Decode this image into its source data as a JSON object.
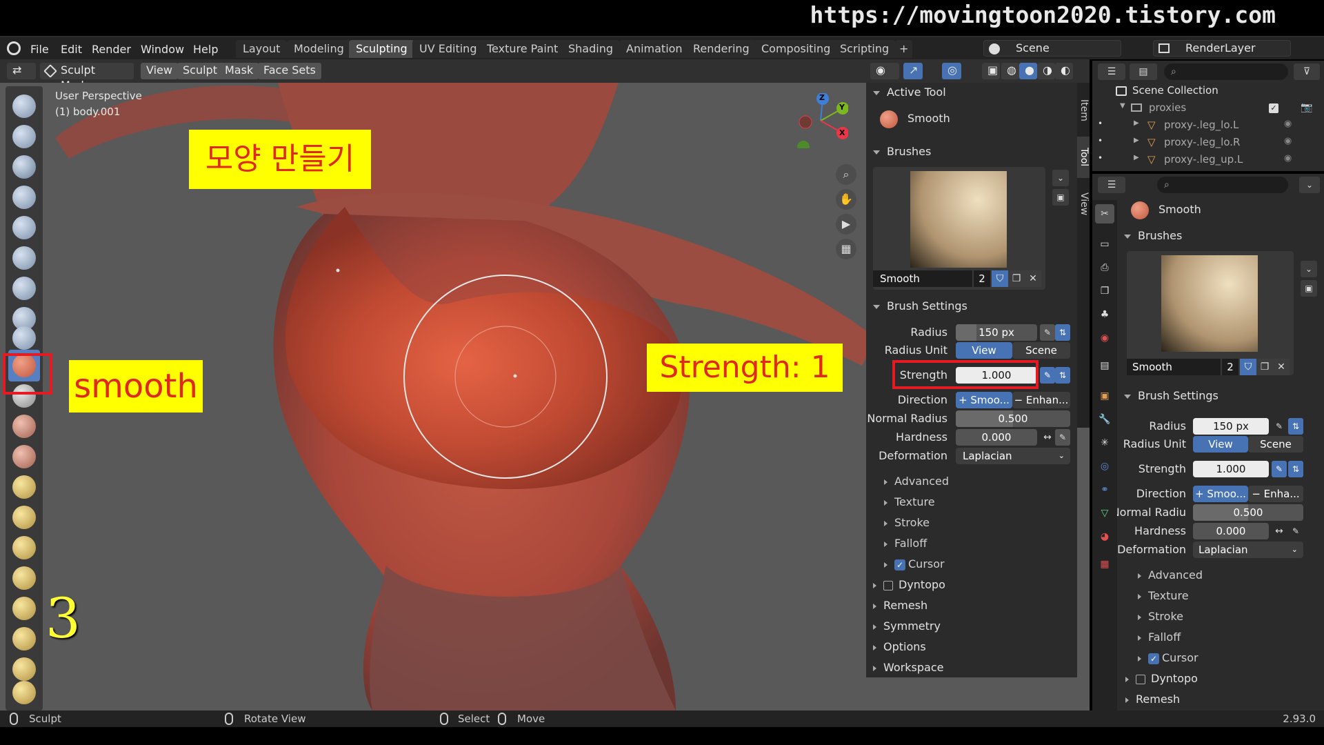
{
  "banner": {
    "url": "https://movingtoon2020.tistory.com"
  },
  "menu": {
    "file": "File",
    "edit": "Edit",
    "render": "Render",
    "window": "Window",
    "help": "Help"
  },
  "workspaces": [
    "Layout",
    "Modeling",
    "Sculpting",
    "UV Editing",
    "Texture Paint",
    "Shading",
    "Animation",
    "Rendering",
    "Compositing",
    "Scripting"
  ],
  "active_workspace": "Sculpting",
  "scene": {
    "scene_label": "Scene",
    "render_layer_label": "RenderLayer"
  },
  "header": {
    "mode": "Sculpt Mode",
    "view": "View",
    "sculpt": "Sculpt",
    "mask": "Mask",
    "face_sets": "Face Sets"
  },
  "viewport": {
    "perspective": "User Perspective",
    "object": "(1) body.001",
    "gizmo": {
      "z": "Z",
      "y": "Y",
      "x": "X"
    }
  },
  "annotations": {
    "title": "모양 만들기",
    "tool_name": "smooth",
    "strength_note": "Strength:  1",
    "step": "3"
  },
  "npanel": {
    "active_tool_header": "Active Tool",
    "active_tool_name": "Smooth",
    "brushes_header": "Brushes",
    "brush_name": "Smooth",
    "brush_users": "2",
    "brush_settings_header": "Brush Settings",
    "radius_label": "Radius",
    "radius_value": "150 px",
    "radius_unit_label": "Radius Unit",
    "radius_unit_view": "View",
    "radius_unit_scene": "Scene",
    "strength_label": "Strength",
    "strength_value": "1.000",
    "direction_label": "Direction",
    "direction_smooth": "+ Smoo...",
    "direction_enhance": "− Enhan...",
    "normal_radius_label": "Normal Radius",
    "normal_radius_value": "0.500",
    "hardness_label": "Hardness",
    "hardness_value": "0.000",
    "deformation_label": "Deformation",
    "deformation_value": "Laplacian",
    "sub_advanced": "Advanced",
    "sub_texture": "Texture",
    "sub_stroke": "Stroke",
    "sub_falloff": "Falloff",
    "sub_cursor": "Cursor",
    "dyntopo": "Dyntopo",
    "remesh": "Remesh",
    "symmetry": "Symmetry",
    "options": "Options",
    "workspace": "Workspace",
    "tabs": [
      "Item",
      "Tool",
      "View"
    ]
  },
  "outliner": {
    "scene_collection": "Scene Collection",
    "proxies": "proxies",
    "items": [
      "proxy-.leg_lo.L",
      "proxy-.leg_lo.R",
      "proxy-.leg_up.L"
    ]
  },
  "props": {
    "tool_name": "Smooth",
    "brushes_header": "Brushes",
    "brush_name": "Smooth",
    "brush_users": "2",
    "brush_settings_header": "Brush Settings",
    "radius_label": "Radius",
    "radius_value": "150 px",
    "radius_unit_label": "Radius Unit",
    "radius_unit_view": "View",
    "radius_unit_scene": "Scene",
    "strength_label": "Strength",
    "strength_value": "1.000",
    "direction_label": "Direction",
    "direction_smooth": "+ Smoo...",
    "direction_enhance": "− Enha...",
    "normal_radius_label": "Normal Radiu",
    "normal_radius_value": "0.500",
    "hardness_label": "Hardness",
    "hardness_value": "0.000",
    "deformation_label": "Deformation",
    "deformation_value": "Laplacian",
    "sub_advanced": "Advanced",
    "sub_texture": "Texture",
    "sub_stroke": "Stroke",
    "sub_falloff": "Falloff",
    "sub_cursor": "Cursor",
    "dyntopo": "Dyntopo",
    "remesh": "Remesh"
  },
  "status": {
    "sculpt": "Sculpt",
    "rotate": "Rotate View",
    "select": "Select",
    "move": "Move",
    "version": "2.93.0"
  },
  "values": {
    "normal_radius_fraction": 0.5,
    "strength_fraction": 1.0
  },
  "colors": {
    "accent": "#4772b3",
    "annotation_yellow": "#ffff00",
    "annotation_red": "#e51b24",
    "mesh": "#b44a35"
  }
}
